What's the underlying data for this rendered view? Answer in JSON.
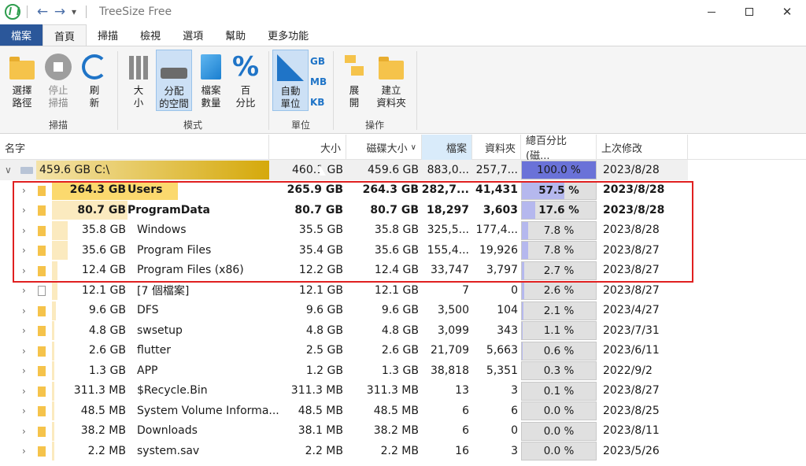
{
  "window": {
    "title": "TreeSize Free"
  },
  "ribbon_tabs": [
    {
      "label": "檔案"
    },
    {
      "label": "首頁"
    },
    {
      "label": "掃描"
    },
    {
      "label": "檢視"
    },
    {
      "label": "選項"
    },
    {
      "label": "幫助"
    },
    {
      "label": "更多功能"
    }
  ],
  "ribbon": {
    "scan_group": {
      "label": "掃描",
      "select_path": "選擇\n路徑",
      "stop_scan": "停止\n掃描",
      "refresh": "刷\n新"
    },
    "mode_group": {
      "label": "模式",
      "size": "大\n小",
      "allocated_space": "分配\n的空間",
      "file_count": "檔案\n數量",
      "percent": "百\n分比"
    },
    "unit_group": {
      "label": "單位",
      "auto_unit": "自動\n單位",
      "gb": "GB",
      "mb": "MB",
      "kb": "KB"
    },
    "action_group": {
      "label": "操作",
      "expand": "展\n開",
      "create_folder": "建立\n資料夾"
    }
  },
  "columns": {
    "name": "名字",
    "size": "大小",
    "disk_size": "磁碟大小",
    "files": "檔案",
    "folders": "資料夾",
    "percent": "總百分比 (磁...",
    "modified": "上次修改"
  },
  "rows": [
    {
      "bar": "459.6 GB",
      "name": "C:\\",
      "size": "460.1 GB",
      "disk": "459.6 GB",
      "files": "883,0...",
      "folders": "257,7...",
      "percent": "100.0 %",
      "pct": 1.0,
      "date": "2023/8/28",
      "bold": false,
      "type": "drive"
    },
    {
      "bar": "264.3 GB",
      "name": "Users",
      "size": "265.9 GB",
      "disk": "264.3 GB",
      "files": "282,7...",
      "folders": "41,431",
      "percent": "57.5 %",
      "pct": 0.575,
      "date": "2023/8/28",
      "bold": true,
      "type": "folder"
    },
    {
      "bar": "80.7 GB",
      "name": "ProgramData",
      "size": "80.7 GB",
      "disk": "80.7 GB",
      "files": "18,297",
      "folders": "3,603",
      "percent": "17.6 %",
      "pct": 0.176,
      "date": "2023/8/28",
      "bold": true,
      "type": "folder"
    },
    {
      "bar": "35.8 GB",
      "name": "Windows",
      "size": "35.5 GB",
      "disk": "35.8 GB",
      "files": "325,5...",
      "folders": "177,4...",
      "percent": "7.8 %",
      "pct": 0.078,
      "date": "2023/8/28",
      "bold": false,
      "type": "folder"
    },
    {
      "bar": "35.6 GB",
      "name": "Program Files",
      "size": "35.4 GB",
      "disk": "35.6 GB",
      "files": "155,4...",
      "folders": "19,926",
      "percent": "7.8 %",
      "pct": 0.078,
      "date": "2023/8/27",
      "bold": false,
      "type": "folder"
    },
    {
      "bar": "12.4 GB",
      "name": "Program Files (x86)",
      "size": "12.2 GB",
      "disk": "12.4 GB",
      "files": "33,747",
      "folders": "3,797",
      "percent": "2.7 %",
      "pct": 0.027,
      "date": "2023/8/27",
      "bold": false,
      "type": "folder"
    },
    {
      "bar": "12.1 GB",
      "name": "[7 個檔案]",
      "size": "12.1 GB",
      "disk": "12.1 GB",
      "files": "7",
      "folders": "0",
      "percent": "2.6 %",
      "pct": 0.026,
      "date": "2023/8/27",
      "bold": false,
      "type": "file"
    },
    {
      "bar": "9.6 GB",
      "name": "DFS",
      "size": "9.6 GB",
      "disk": "9.6 GB",
      "files": "3,500",
      "folders": "104",
      "percent": "2.1 %",
      "pct": 0.021,
      "date": "2023/4/27",
      "bold": false,
      "type": "folder"
    },
    {
      "bar": "4.8 GB",
      "name": "swsetup",
      "size": "4.8 GB",
      "disk": "4.8 GB",
      "files": "3,099",
      "folders": "343",
      "percent": "1.1 %",
      "pct": 0.011,
      "date": "2023/7/31",
      "bold": false,
      "type": "folder"
    },
    {
      "bar": "2.6 GB",
      "name": "flutter",
      "size": "2.5 GB",
      "disk": "2.6 GB",
      "files": "21,709",
      "folders": "5,663",
      "percent": "0.6 %",
      "pct": 0.006,
      "date": "2023/6/11",
      "bold": false,
      "type": "folder"
    },
    {
      "bar": "1.3 GB",
      "name": "APP",
      "size": "1.2 GB",
      "disk": "1.3 GB",
      "files": "38,818",
      "folders": "5,351",
      "percent": "0.3 %",
      "pct": 0.003,
      "date": "2022/9/2",
      "bold": false,
      "type": "folder"
    },
    {
      "bar": "311.3 MB",
      "name": "$Recycle.Bin",
      "size": "311.3 MB",
      "disk": "311.3 MB",
      "files": "13",
      "folders": "3",
      "percent": "0.1 %",
      "pct": 0.001,
      "date": "2023/8/27",
      "bold": false,
      "type": "folder"
    },
    {
      "bar": "48.5 MB",
      "name": "System Volume Informa...",
      "size": "48.5 MB",
      "disk": "48.5 MB",
      "files": "6",
      "folders": "6",
      "percent": "0.0 %",
      "pct": 0.0,
      "date": "2023/8/25",
      "bold": false,
      "type": "folder"
    },
    {
      "bar": "38.2 MB",
      "name": "Downloads",
      "size": "38.1 MB",
      "disk": "38.2 MB",
      "files": "6",
      "folders": "0",
      "percent": "0.0 %",
      "pct": 0.0,
      "date": "2023/8/11",
      "bold": false,
      "type": "folder"
    },
    {
      "bar": "2.2 MB",
      "name": "system.sav",
      "size": "2.2 MB",
      "disk": "2.2 MB",
      "files": "16",
      "folders": "3",
      "percent": "0.0 %",
      "pct": 0.0,
      "date": "2023/5/26",
      "bold": false,
      "type": "folder"
    }
  ],
  "colors": {
    "file_tab": "#2b579a",
    "folder": "#f5c34b",
    "percent_fill": "#b5b8ee",
    "percent_full": "#6a72d8",
    "highlight_border": "#e02020"
  }
}
